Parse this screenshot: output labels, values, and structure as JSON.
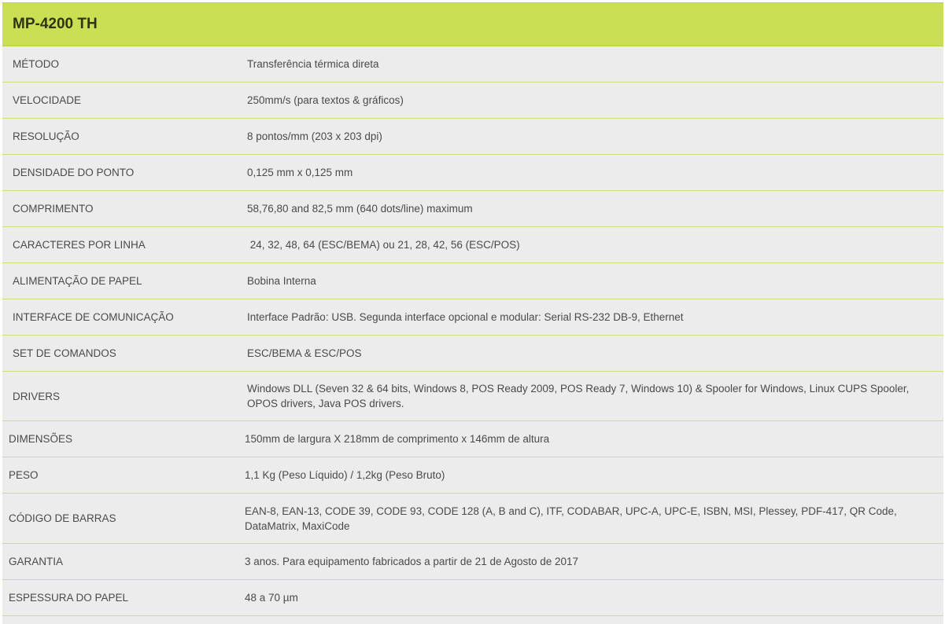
{
  "title": "MP-4200 TH",
  "rows": [
    {
      "label": "MÉTODO",
      "value": "Transferência térmica direta"
    },
    {
      "label": "VELOCIDADE",
      "value": "250mm/s (para textos & gráficos)"
    },
    {
      "label": "RESOLUÇÃO",
      "value": "8 pontos/mm (203 x 203 dpi)"
    },
    {
      "label": "DENSIDADE DO PONTO",
      "value": "0,125 mm x 0,125 mm"
    },
    {
      "label": "COMPRIMENTO",
      "value": "58,76,80 and 82,5 mm (640 dots/line) maximum"
    },
    {
      "label": "CARACTERES POR LINHA",
      "value": " 24, 32, 48, 64 (ESC/BEMA) ou 21, 28, 42, 56 (ESC/POS)"
    },
    {
      "label": "ALIMENTAÇÃO DE PAPEL",
      "value": "Bobina Interna"
    },
    {
      "label": "INTERFACE DE COMUNICAÇÃO",
      "value": "Interface Padrão: USB. Segunda interface opcional e modular: Serial RS-232 DB-9, Ethernet"
    },
    {
      "label": "SET DE COMANDOS",
      "value": "ESC/BEMA & ESC/POS"
    },
    {
      "label": "DRIVERS",
      "value": "Windows DLL (Seven 32 & 64 bits, Windows 8, POS Ready 2009, POS Ready 7, Windows 10) & Spooler for Windows, Linux CUPS Spooler, OPOS drivers, Java POS drivers."
    },
    {
      "label": "DIMENSÕES",
      "value": "150mm de largura X 218mm de comprimento x 146mm de altura"
    },
    {
      "label": "PESO",
      "value": "1,1 Kg (Peso Líquido) / 1,2kg (Peso Bruto)"
    },
    {
      "label": "CÓDIGO DE BARRAS",
      "value": "EAN-8, EAN-13, CODE 39, CODE 93, CODE 128 (A, B and C), ITF, CODABAR, UPC-A, UPC-E, ISBN, MSI, Plessey, PDF-417, QR Code, DataMatrix, MaxiCode"
    },
    {
      "label": "GARANTIA",
      "value": "3 anos. Para equipamento fabricados a partir de 21 de Agosto de 2017"
    },
    {
      "label": "ESPESSURA DO PAPEL",
      "value": "48 a 70 µm"
    }
  ],
  "colors": {
    "header_bg": "#cbdf55",
    "row_bg": "#ececec",
    "divider": "#cfe07a"
  }
}
